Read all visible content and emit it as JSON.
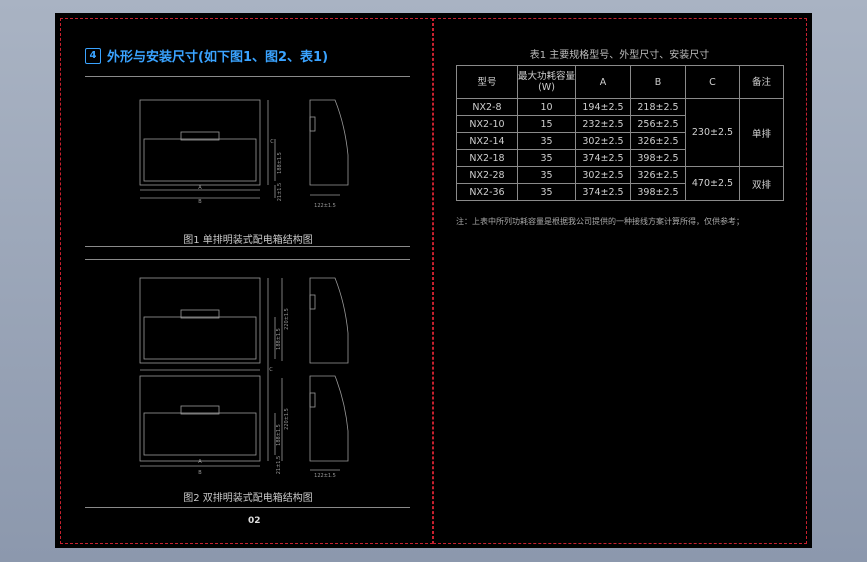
{
  "section": {
    "number": "4",
    "title": "外形与安装尺寸(如下图1、图2、表1)"
  },
  "fig1": {
    "caption": "图1 单排明装式配电箱结构图",
    "dim_A": "A",
    "dim_B": "B",
    "dim_C": "C",
    "dim_h1": "188±1.5",
    "dim_h2": "21±1.5",
    "dim_depth": "122±1.5"
  },
  "fig2": {
    "caption": "图2 双排明装式配电箱结构图",
    "dim_A": "A",
    "dim_B": "B",
    "dim_C": "C",
    "dim_h1": "188±1.5",
    "dim_h2": "220±1.5",
    "dim_h3": "21±1.5",
    "dim_depth": "122±1.5"
  },
  "page_number": "02",
  "table": {
    "caption": "表1 主要规格型号、外型尺寸、安装尺寸",
    "headers": [
      "型号",
      "最大功耗容量(W)",
      "A",
      "B",
      "C",
      "备注"
    ],
    "rows": [
      [
        "NX2-8",
        "10",
        "194±2.5",
        "218±2.5"
      ],
      [
        "NX2-10",
        "15",
        "232±2.5",
        "256±2.5"
      ],
      [
        "NX2-14",
        "35",
        "302±2.5",
        "326±2.5"
      ],
      [
        "NX2-18",
        "35",
        "374±2.5",
        "398±2.5"
      ],
      [
        "NX2-28",
        "35",
        "302±2.5",
        "326±2.5"
      ],
      [
        "NX2-36",
        "35",
        "374±2.5",
        "398±2.5"
      ]
    ],
    "group1": {
      "c": "230±2.5",
      "note": "单排"
    },
    "group2": {
      "c": "470±2.5",
      "note": "双排"
    },
    "footnote": "注：上表中所列功耗容量是根据我公司提供的一种接线方案计算所得，仅供参考；"
  },
  "colors": {
    "frame_dash": "#c8202e",
    "title_blue": "#3aa3ff",
    "line_gray": "#8a8a8a"
  }
}
